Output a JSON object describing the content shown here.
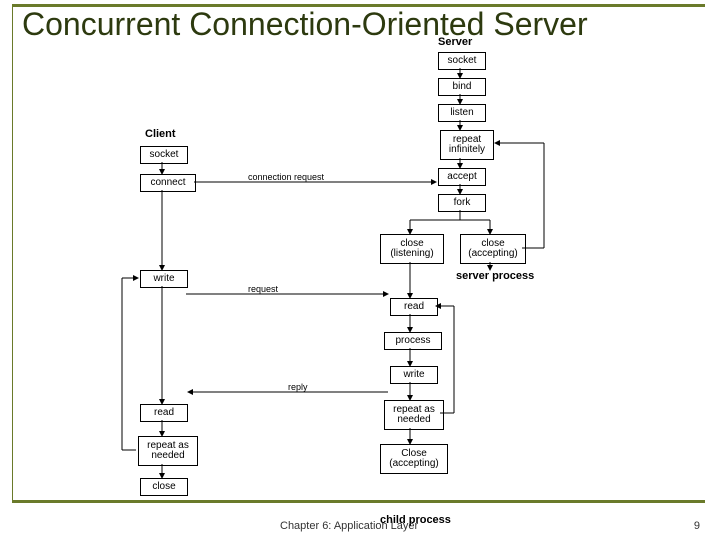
{
  "title": "Concurrent Connection-Oriented Server",
  "footer": "Chapter 6: Application Layer",
  "page": "9",
  "labels": {
    "server": "Server",
    "client": "Client",
    "server_process": "server process",
    "child_process": "child process",
    "conn_req": "connection request",
    "request": "request",
    "reply": "reply"
  },
  "boxes": {
    "client_socket": "socket",
    "client_connect": "connect",
    "client_write": "write",
    "client_read": "read",
    "client_repeat": "repeat as needed",
    "client_close": "close",
    "srv_socket": "socket",
    "srv_bind": "bind",
    "srv_listen": "listen",
    "srv_repeat_inf": "repeat infinitely",
    "srv_accept": "accept",
    "srv_fork": "fork",
    "srv_close_listen": "close (listening)",
    "srv_close_accept": "close (accepting)",
    "cp_read": "read",
    "cp_process": "process",
    "cp_write": "write",
    "cp_repeat_needed": "repeat as needed",
    "cp_close_accept": "Close (accepting)"
  }
}
